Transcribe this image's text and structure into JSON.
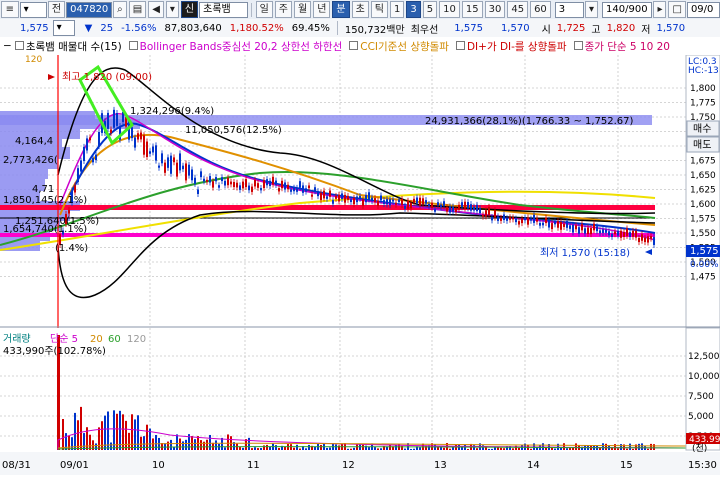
{
  "toolbar1": {
    "code": "047820",
    "name": "초록뱀",
    "period_buttons": [
      "일",
      "주",
      "월",
      "년",
      "분",
      "초",
      "틱"
    ],
    "active_period": "분",
    "intervals": [
      "1",
      "3",
      "5",
      "10",
      "15",
      "30",
      "45",
      "60"
    ],
    "active_interval": "3",
    "stepper_value": "3",
    "count": "140/900",
    "date": "09/0"
  },
  "toolbar2": {
    "price": "1,575",
    "change": "25",
    "change_pct": "-1.56%",
    "volume": "87,803,640",
    "volume_ratio": "1,180.52%",
    "turnover": "69.45%",
    "amount": "150,732백만",
    "best_ask_label": "최우선",
    "best_ask": "1,575",
    "best_bid": "1,570",
    "open_label": "시",
    "open": "1,725",
    "high_label": "고",
    "high": "1,820",
    "low_label": "저",
    "low": "1,570"
  },
  "indicators": {
    "items": [
      {
        "label": "초록뱀 매물대 수(15)",
        "color": "#000000"
      },
      {
        "label": "Bollinger Bands중심선 20,2  상한선  하한선",
        "color": "#cc00cc"
      },
      {
        "label": "CCI기준선 상향돌파",
        "color": "#d08a00"
      },
      {
        "label": "DI+가 DI-를 상향돌파",
        "color": "#cc0000"
      },
      {
        "label": "종가 단순 5 10 20",
        "color": "#cc0066"
      }
    ],
    "lc_label": "LC:0.3",
    "hc_label": "HC:-13"
  },
  "price_axis": {
    "ticks": [
      "1,800",
      "1,775",
      "1,750",
      "1,725",
      "1,700",
      "1,675",
      "1,650",
      "1,625",
      "1,600",
      "1,575",
      "1,550",
      "1,525",
      "1,500",
      "1,475"
    ],
    "current_price_tag": "1,575",
    "pct_tag": "0.00%"
  },
  "side_buttons": {
    "sell": "매수",
    "buy": "매도",
    "sell_bottom": "매수"
  },
  "annotations": {
    "high": "최고 1,820 (09:00)",
    "low": "최저 1,570 (15:18)",
    "top_value_right": "24,931,366(28.1%)(1,766.33 ~ 1,752.67)",
    "top_value_mid": "1,324,296(9.4%)",
    "value_a": "11,050,576(12.5%)",
    "value_b": "4,164,4",
    "value_c": "2,773,426(",
    "value_d": "1,850,145(2.1%)",
    "value_e": "1,251,640(1.5%)",
    "value_f": "1,654,740(1.1%)",
    "value_g": "4,71",
    "value_h": "(1.4%)",
    "chart_mark": "120"
  },
  "volume_panel": {
    "legend": [
      "거래량",
      "단순 5",
      "20",
      "60",
      "120"
    ],
    "legend_colors": [
      "#008080",
      "#cc00cc",
      "#d08a00",
      "#2ca02c",
      "#999999"
    ],
    "volume_label": "433,990주(102.78%)",
    "axis_ticks": [
      "12,500",
      "10,000",
      "7,500",
      "5,000",
      "2,500"
    ],
    "unit_label": "(천)",
    "current_volume_tag": "433.99"
  },
  "time_axis": {
    "labels": [
      "08/31",
      "09/01",
      "10",
      "11",
      "12",
      "13",
      "14",
      "15",
      "15:30"
    ]
  },
  "colors": {
    "up": "#d00000",
    "down": "#0033cc",
    "ma5": "#cc00cc",
    "ma10": "#0033cc",
    "ma20": "#e09000",
    "ma60": "#2ca02c",
    "ma120": "#f0e000",
    "bollinger": "#000000",
    "volume_profile": "#8a8af0",
    "resistance": "#ff0066"
  }
}
